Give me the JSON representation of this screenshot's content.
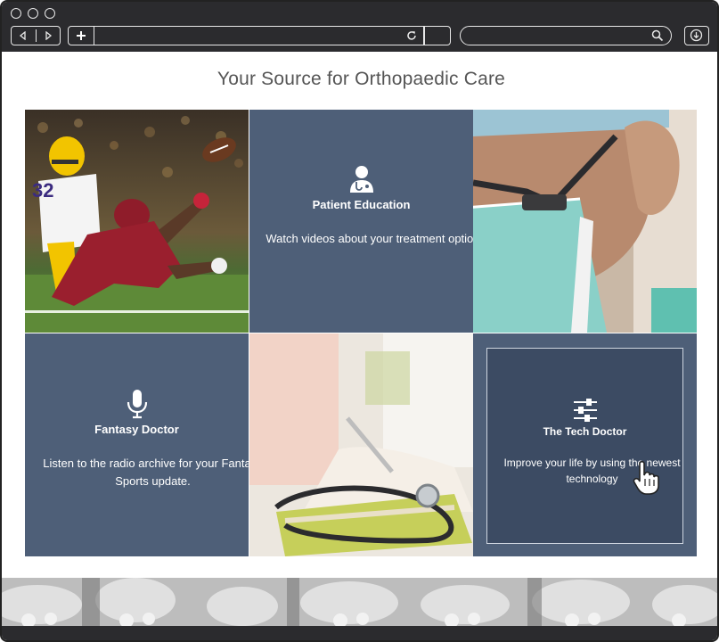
{
  "browser": {
    "back_icon": "back-arrow-icon",
    "forward_icon": "forward-arrow-icon",
    "new_tab_icon": "plus-icon",
    "reload_icon": "reload-icon",
    "search_icon": "magnifier-icon",
    "download_icon": "download-icon",
    "address_value": "",
    "search_value": ""
  },
  "page": {
    "title": "Your Source for Orthopaedic Care"
  },
  "tiles": {
    "patient_education": {
      "icon": "doctor-icon",
      "heading": "Patient Education",
      "description": "Watch videos about your treatment options."
    },
    "fantasy_doctor": {
      "icon": "microphone-icon",
      "heading": "Fantasy Doctor",
      "description": "Listen to the radio archive for your Fantasy Sports update."
    },
    "tech_doctor": {
      "icon": "sliders-icon",
      "heading": "The Tech Doctor",
      "description": "Improve your life by using the newest technology"
    }
  },
  "images": {
    "football": "football-player-diving-photo",
    "surgeon": "surgeon-wearing-smart-glasses-photo",
    "stethoscope": "stethoscope-on-book-photo",
    "footer": "baby-feet-photo"
  },
  "colors": {
    "tile_blue": "#4e5f78",
    "tile_dark": "#3c4b63",
    "chrome": "#2b2b2e"
  }
}
